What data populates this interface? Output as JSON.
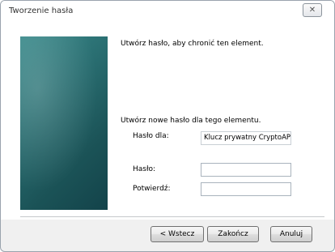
{
  "window": {
    "title": "Tworzenie hasła",
    "close_glyph": "✕"
  },
  "content": {
    "intro": "Utwórz hasło, aby chronić ten element.",
    "section_heading": "Utwórz nowe hasło dla tego elementu.",
    "password_for_label": "Hasło dla:",
    "password_for_value": "Klucz prywatny CryptoAPI",
    "password_label": "Hasło:",
    "password_value": "",
    "confirm_label": "Potwierdź:",
    "confirm_value": ""
  },
  "buttons": {
    "back": "< Wstecz",
    "finish": "Zakończ",
    "cancel": "Anuluj"
  },
  "colors": {
    "banner_top": "#3a8a8b",
    "banner_bottom": "#13434a"
  }
}
